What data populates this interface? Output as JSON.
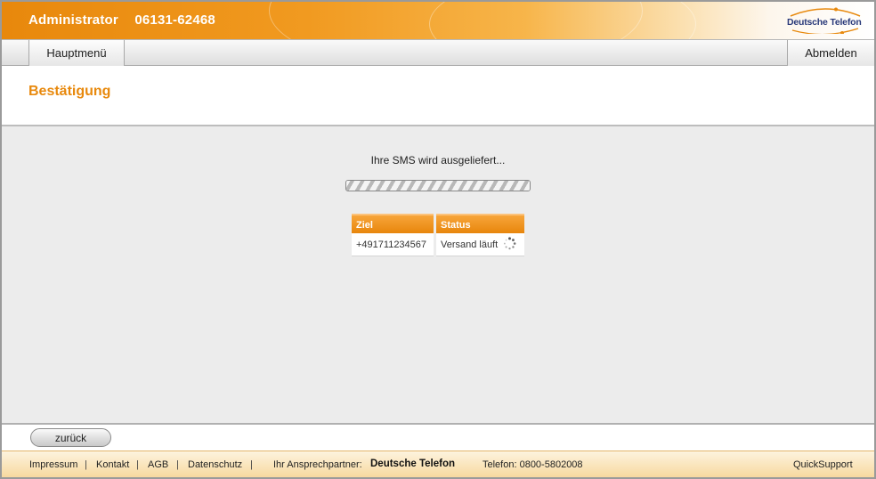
{
  "header": {
    "user_label": "Administrator",
    "phone_number": "06131-62468",
    "logo_text": "Deutsche Telefon",
    "colors": {
      "accent": "#e8890d",
      "logo": "#2a3a7a"
    }
  },
  "nav": {
    "main_menu": "Hauptmenü",
    "logout": "Abmelden"
  },
  "page": {
    "title": "Bestätigung"
  },
  "main": {
    "message": "Ihre SMS wird ausgeliefert...",
    "progress_indeterminate": true,
    "table": {
      "headers": {
        "target": "Ziel",
        "status": "Status"
      },
      "rows": [
        {
          "target": "+491711234567",
          "status": "Versand läuft",
          "status_icon": "loading-spinner-icon"
        }
      ]
    }
  },
  "bottom": {
    "back_label": "zurück"
  },
  "footer": {
    "impressum": "Impressum",
    "kontakt": "Kontakt",
    "agb": "AGB",
    "datenschutz": "Datenschutz",
    "separator": "|",
    "contact_label": "Ihr Ansprechpartner:",
    "contact_name": "Deutsche Telefon",
    "phone": "Telefon: 0800-5802008",
    "quicksupport": "QuickSupport"
  }
}
